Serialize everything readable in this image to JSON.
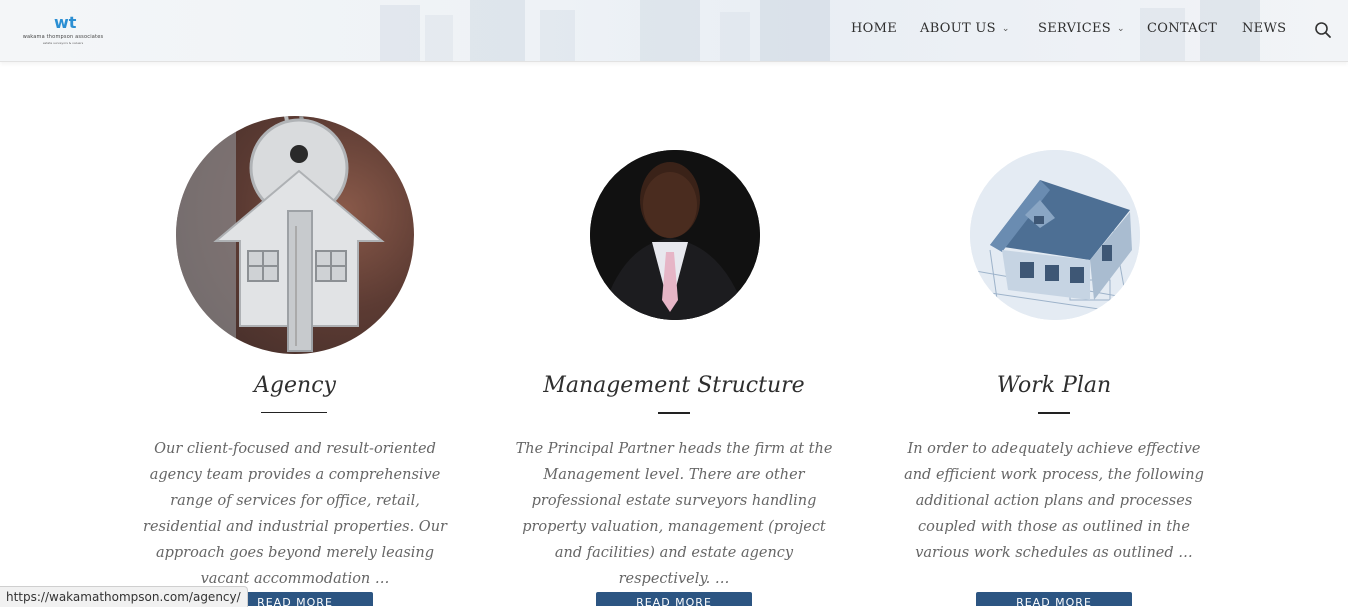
{
  "header": {
    "logo": {
      "mark": "wt",
      "name": "wakama thompson associates",
      "tagline": "estate surveyors & valuers"
    },
    "nav": [
      {
        "label": "HOME",
        "dropdown": false
      },
      {
        "label": "ABOUT US",
        "dropdown": true
      },
      {
        "label": "SERVICES",
        "dropdown": true
      },
      {
        "label": "CONTACT",
        "dropdown": false
      },
      {
        "label": "NEWS",
        "dropdown": false
      }
    ],
    "search_icon": "search-icon"
  },
  "columns": [
    {
      "image": "house-key-photo",
      "title": "Agency",
      "description": "Our client-focused and result-oriented agency team provides a comprehensive range of services for office, retail, residential and industrial properties. Our approach goes beyond merely leasing vacant accommodation …",
      "button": "READ MORE"
    },
    {
      "image": "principal-partner-portrait",
      "title": "Management Structure",
      "description": "The Principal Partner heads the firm at the Management level. There are other professional estate surveyors handling property valuation, management (project and facilities) and estate agency respectively. …",
      "button": "READ MORE"
    },
    {
      "image": "house-blueprint-photo",
      "title": "Work Plan",
      "description": "In order to adequately achieve effective and efficient work process, the following additional action plans and processes coupled with those as outlined in the various work schedules as outlined …",
      "button": "READ MORE"
    }
  ],
  "status_bar": {
    "url": "https://wakamathompson.com/agency/"
  },
  "colors": {
    "button_bg": "#2c5582",
    "logo_accent": "#2b8fd3",
    "title_text": "#2e2e2e",
    "body_text": "#666666"
  }
}
